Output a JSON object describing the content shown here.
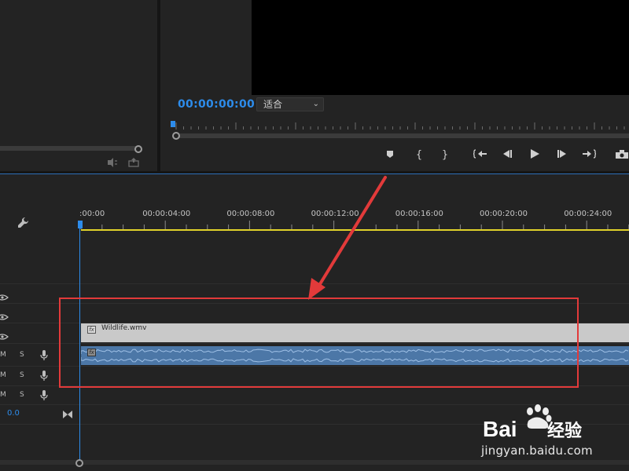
{
  "program_monitor": {
    "timecode": "00:00:00:00",
    "fit_select": {
      "value": "适合"
    },
    "controls": [
      "add-marker",
      "mark-in",
      "mark-out",
      "go-to-in",
      "step-back",
      "play",
      "step-forward",
      "go-to-out",
      "export-frame"
    ]
  },
  "source_panel": {
    "icons": [
      "drag-audio-icon",
      "export-icon"
    ]
  },
  "timeline": {
    "ruler": [
      {
        "label": ":00:00",
        "t": 0
      },
      {
        "label": "00:00:04:00",
        "t": 4
      },
      {
        "label": "00:00:08:00",
        "t": 8
      },
      {
        "label": "00:00:12:00",
        "t": 12
      },
      {
        "label": "00:00:16:00",
        "t": 16
      },
      {
        "label": "00:00:20:00",
        "t": 20
      },
      {
        "label": "00:00:24:00",
        "t": 24
      }
    ],
    "audio_tracks": [
      {
        "m": "M",
        "s": "S"
      },
      {
        "m": "M",
        "s": "S"
      },
      {
        "m": "M",
        "s": "S"
      }
    ],
    "video_clip": {
      "name": "Wildlife.wmv",
      "fx": "fx"
    },
    "audio_clip": {
      "fx": "fx"
    },
    "master_volume": "0.0"
  },
  "watermark": {
    "logo_text": "Baidu经验",
    "url": "jingyan.baidu.com"
  },
  "colors": {
    "accent_blue": "#2d8ceb",
    "annotation_red": "#e23a3a",
    "audio_clip": "#4c77a7",
    "video_clip": "#c9c9c9",
    "work_area": "#e0d22a"
  }
}
